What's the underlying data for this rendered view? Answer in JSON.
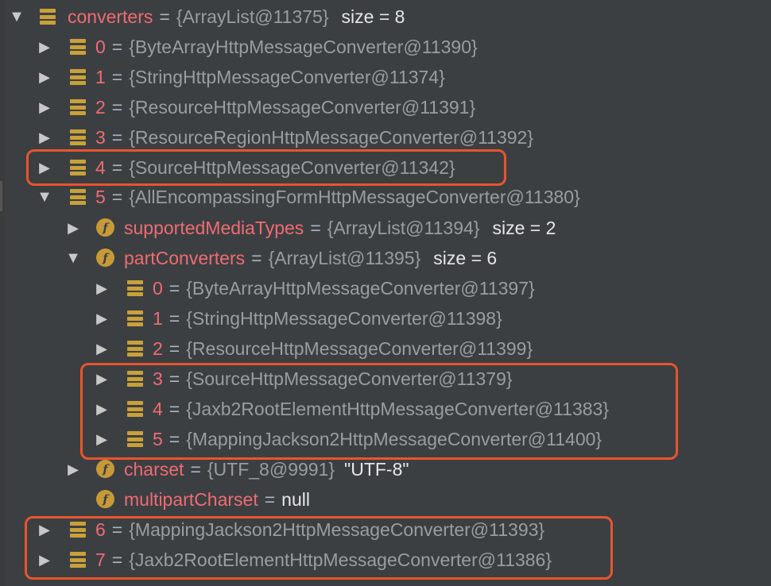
{
  "root": {
    "name": "converters",
    "ref": "{ArrayList@11375}",
    "size": "size = 8"
  },
  "items": [
    {
      "index": "0",
      "ref": "{ByteArrayHttpMessageConverter@11390}"
    },
    {
      "index": "1",
      "ref": "{StringHttpMessageConverter@11374}"
    },
    {
      "index": "2",
      "ref": "{ResourceHttpMessageConverter@11391}"
    },
    {
      "index": "3",
      "ref": "{ResourceRegionHttpMessageConverter@11392}"
    },
    {
      "index": "4",
      "ref": "{SourceHttpMessageConverter@11342}"
    },
    {
      "index": "5",
      "ref": "{AllEncompassingFormHttpMessageConverter@11380}"
    },
    {
      "index": "6",
      "ref": "{MappingJackson2HttpMessageConverter@11393}"
    },
    {
      "index": "7",
      "ref": "{Jaxb2RootElementHttpMessageConverter@11386}"
    }
  ],
  "fields": {
    "supportedMediaTypes": {
      "name": "supportedMediaTypes",
      "ref": "{ArrayList@11394}",
      "size": "size = 2"
    },
    "partConverters": {
      "name": "partConverters",
      "ref": "{ArrayList@11395}",
      "size": "size = 6"
    },
    "charset": {
      "name": "charset",
      "ref": "{UTF_8@9991}",
      "value": "\"UTF-8\""
    },
    "multipartCharset": {
      "name": "multipartCharset",
      "value": "null"
    }
  },
  "part_items": [
    {
      "index": "0",
      "ref": "{ByteArrayHttpMessageConverter@11397}"
    },
    {
      "index": "1",
      "ref": "{StringHttpMessageConverter@11398}"
    },
    {
      "index": "2",
      "ref": "{ResourceHttpMessageConverter@11399}"
    },
    {
      "index": "3",
      "ref": "{SourceHttpMessageConverter@11379}"
    },
    {
      "index": "4",
      "ref": "{Jaxb2RootElementHttpMessageConverter@11383}"
    },
    {
      "index": "5",
      "ref": "{MappingJackson2HttpMessageConverter@11400}"
    }
  ],
  "equals": "=",
  "field_icon_letter": "f",
  "colors": {
    "background": "#3c3f41",
    "name": "#ef6b73",
    "ref": "#9a9da0",
    "highlight": "#e8542f",
    "icon": "#c9a13a"
  }
}
